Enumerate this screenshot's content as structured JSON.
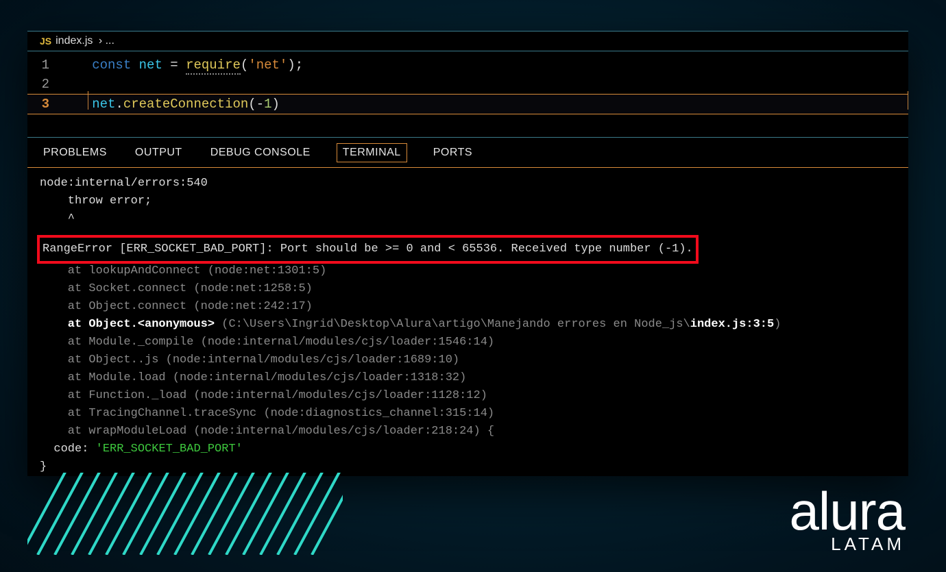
{
  "breadcrumb": {
    "icon_label": "JS",
    "file": "index.js",
    "separator": "›",
    "trail": "..."
  },
  "code": {
    "lines": [
      {
        "n": "1",
        "tokens": [
          {
            "t": "const ",
            "c": "tk-keyword"
          },
          {
            "t": "net",
            "c": "tk-var"
          },
          {
            "t": " = ",
            "c": "tk-plain"
          },
          {
            "t": "require",
            "c": "tk-func"
          },
          {
            "t": "(",
            "c": "tk-plain"
          },
          {
            "t": "'net'",
            "c": "tk-string"
          },
          {
            "t": ");",
            "c": "tk-plain"
          }
        ]
      },
      {
        "n": "2",
        "tokens": []
      },
      {
        "n": "3",
        "active": true,
        "tokens": [
          {
            "t": "net",
            "c": "tk-var"
          },
          {
            "t": ".",
            "c": "tk-plain"
          },
          {
            "t": "createConnection",
            "c": "tk-func"
          },
          {
            "t": "(",
            "c": "tk-plain"
          },
          {
            "t": "-",
            "c": "tk-plain"
          },
          {
            "t": "1",
            "c": "tk-num"
          },
          {
            "t": ")",
            "c": "tk-plain"
          }
        ]
      }
    ]
  },
  "panelTabs": [
    {
      "label": "PROBLEMS",
      "active": false
    },
    {
      "label": "OUTPUT",
      "active": false
    },
    {
      "label": "DEBUG CONSOLE",
      "active": false
    },
    {
      "label": "TERMINAL",
      "active": true
    },
    {
      "label": "PORTS",
      "active": false
    }
  ],
  "terminal": {
    "preamble": [
      "node:internal/errors:540",
      "    throw error;",
      "    ^"
    ],
    "errorLine": "RangeError [ERR_SOCKET_BAD_PORT]: Port should be >= 0 and < 65536. Received type number (-1).",
    "stack": [
      {
        "indent": "    ",
        "text": "at lookupAndConnect (node:net:1301:5)",
        "dim": true
      },
      {
        "indent": "    ",
        "text": "at Socket.connect (node:net:1258:5)",
        "dim": true
      },
      {
        "indent": "    ",
        "text": "at Object.connect (node:net:242:17)",
        "dim": true
      },
      {
        "indent": "    ",
        "prefix": "at Object.<anonymous>",
        "pathDim": " (C:\\Users\\Ingrid\\Desktop\\Alura\\artigo\\Manejando errores en Node_js\\",
        "fileWhite": "index.js:3:5",
        "suffix": ")"
      },
      {
        "indent": "    ",
        "text": "at Module._compile (node:internal/modules/cjs/loader:1546:14)",
        "dim": true
      },
      {
        "indent": "    ",
        "text": "at Object..js (node:internal/modules/cjs/loader:1689:10)",
        "dim": true
      },
      {
        "indent": "    ",
        "text": "at Module.load (node:internal/modules/cjs/loader:1318:32)",
        "dim": true
      },
      {
        "indent": "    ",
        "text": "at Function._load (node:internal/modules/cjs/loader:1128:12)",
        "dim": true
      },
      {
        "indent": "    ",
        "text": "at TracingChannel.traceSync (node:diagnostics_channel:315:14)",
        "dim": true
      },
      {
        "indent": "    ",
        "text": "at wrapModuleLoad (node:internal/modules/cjs/loader:218:24) {",
        "dim": true
      }
    ],
    "codeLine": {
      "key": "  code: ",
      "value": "'ERR_SOCKET_BAD_PORT'"
    },
    "closing": "}"
  },
  "logo": {
    "brand": "alura",
    "sub": "LATAM"
  }
}
